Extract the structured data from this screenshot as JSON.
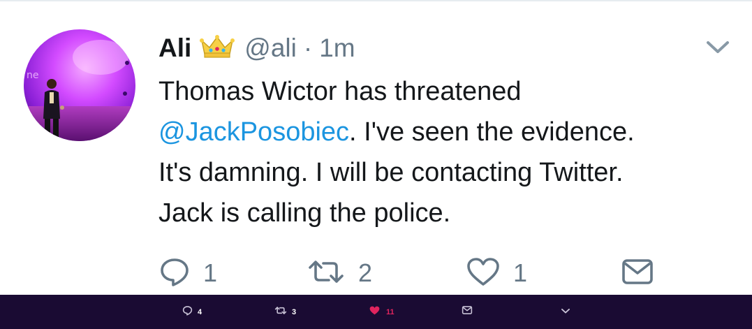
{
  "tweet": {
    "author_name": "Ali",
    "handle": "@ali",
    "separator": "·",
    "timestamp": "1m",
    "badge_icon": "crown-icon",
    "text_lines": [
      {
        "mention": "",
        "text": "Thomas Wictor has threatened"
      },
      {
        "mention": "@JackPosobiec",
        "text": ". I've seen the evidence."
      },
      {
        "mention": "",
        "text": "It's damning. I will be contacting Twitter."
      },
      {
        "mention": "",
        "text": "Jack is calling the police."
      }
    ],
    "actions": {
      "reply_count": "1",
      "retweet_count": "2",
      "like_count": "1"
    }
  },
  "bottom_bar": {
    "reply_count": "4",
    "retweet_count": "3",
    "like_count": "11",
    "background": "#1a0b33",
    "like_color": "#e0245e"
  },
  "colors": {
    "text": "#14171a",
    "secondary": "#657786",
    "link": "#1b95e0"
  }
}
